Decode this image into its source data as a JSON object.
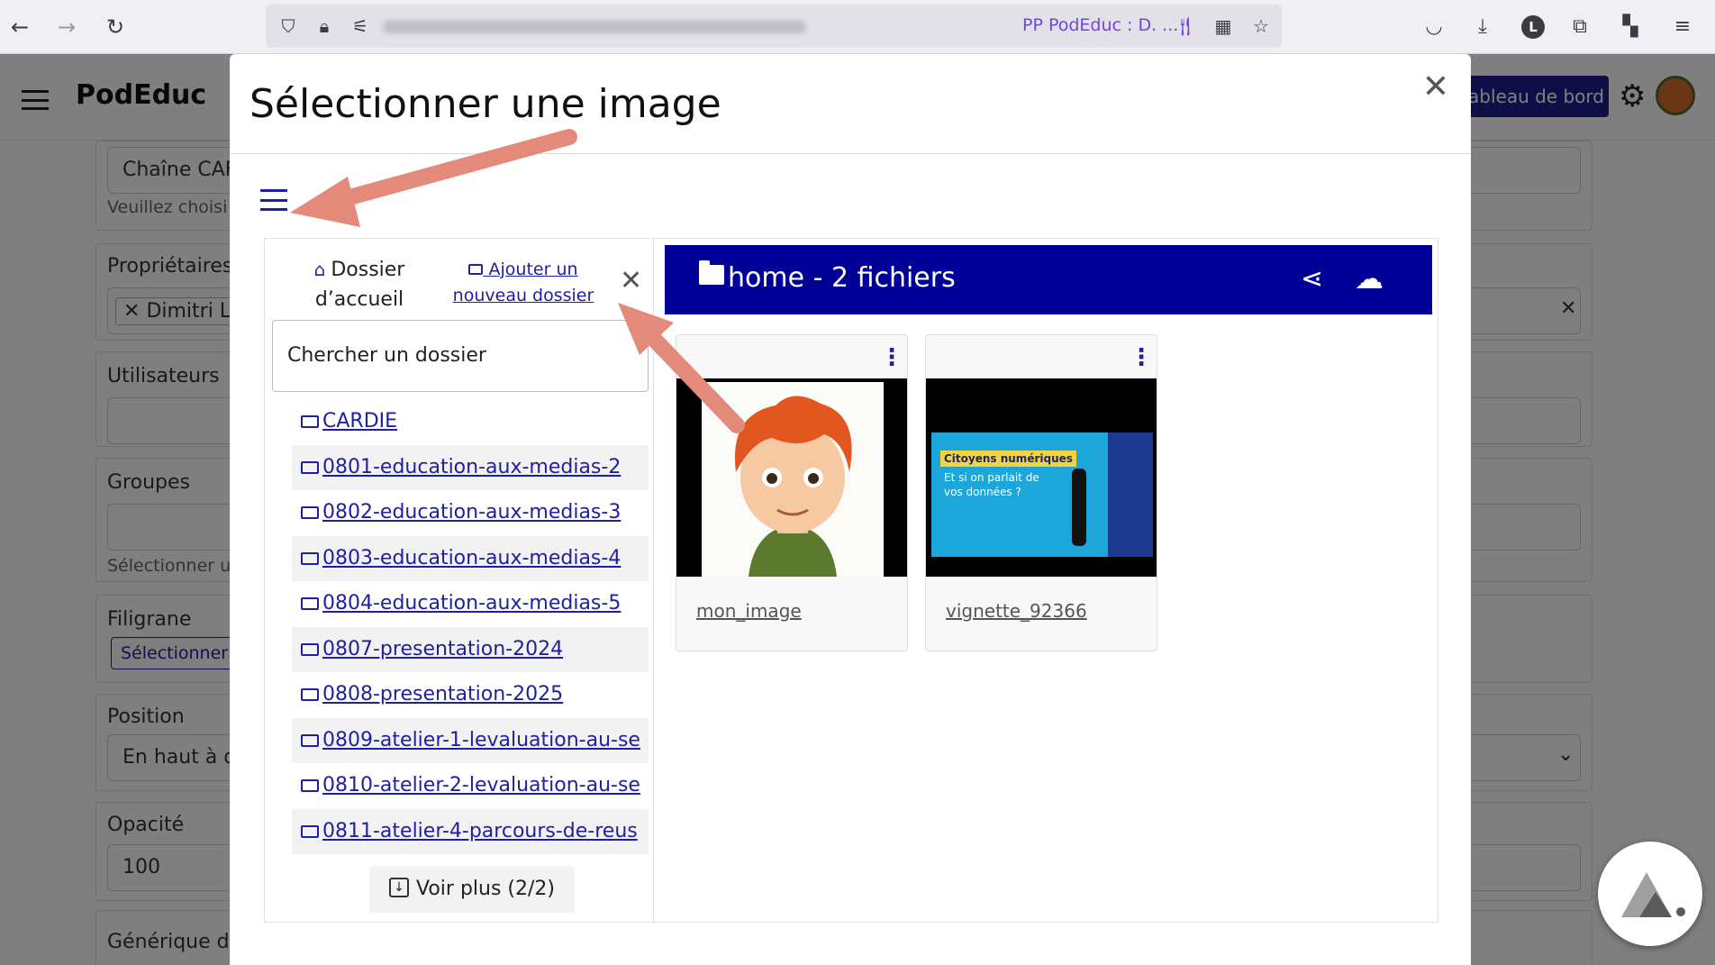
{
  "browser": {
    "tab_label": "PP PodEduc : D. ...",
    "profile_initial": "L"
  },
  "app": {
    "brand": "PodEduc",
    "dashboard_button": "ableau de bord",
    "form": {
      "channel_value": "Chaîne CAF",
      "channel_help": "Veuillez choisi",
      "owners_label": "Propriétaires",
      "owner_tag": "Dimitri L",
      "users_label": "Utilisateurs",
      "groups_label": "Groupes",
      "groups_help": "Sélectionner u",
      "watermark_label": "Filigrane",
      "watermark_button": "Sélectionner",
      "position_label": "Position",
      "position_value": "En haut à d",
      "opacity_label": "Opacité",
      "opacity_value": "100",
      "credits_label": "Générique de"
    }
  },
  "modal": {
    "title": "Sélectionner une image",
    "sidebar": {
      "home_label": "Dossier d’accueil",
      "add_folder_label": " Ajouter un nouveau dossier",
      "search_placeholder": "Chercher un dossier",
      "folders": [
        "CARDIE",
        "0801-education-aux-medias-2",
        "0802-education-aux-medias-3",
        "0803-education-aux-medias-4",
        "0804-education-aux-medias-5",
        "0807-presentation-2024",
        "0808-presentation-2025",
        "0809-atelier-1-levaluation-au-se",
        "0810-atelier-2-levaluation-au-se",
        "0811-atelier-4-parcours-de-reus"
      ],
      "more_label": "Voir plus (2/2)"
    },
    "files_panel": {
      "title": "home - 2 fichiers",
      "files": [
        {
          "name": "mon_image"
        },
        {
          "name": "vignette_92366",
          "thumb_title": "Citoyens numériques",
          "thumb_subtitle": "Et si on parlait de vos données ?"
        }
      ]
    }
  },
  "colors": {
    "primary": "#000096",
    "link": "#1f1fa0",
    "annotation_arrow": "#e48a7a",
    "tab_accent": "#7542e5"
  }
}
